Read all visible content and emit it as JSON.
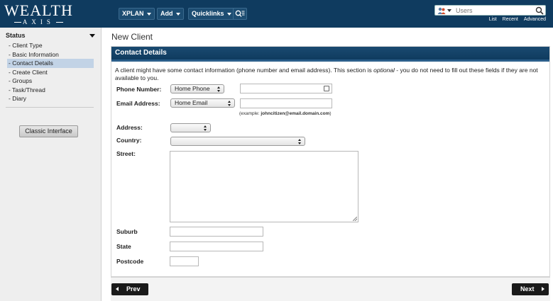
{
  "header": {
    "logo_top": "WEALTH",
    "logo_bottom": "AXIS",
    "nav": [
      {
        "label": "XPLAN"
      },
      {
        "label": "Add"
      },
      {
        "label": "Quicklinks"
      }
    ],
    "user_search_placeholder": "Users",
    "links": [
      "List",
      "Recent",
      "Advanced"
    ]
  },
  "sidebar": {
    "heading": "Status",
    "items": [
      {
        "label": "- Client Type"
      },
      {
        "label": "- Basic Information"
      },
      {
        "label": "- Contact Details"
      },
      {
        "label": "- Create Client"
      },
      {
        "label": "- Groups"
      },
      {
        "label": "- Task/Thread"
      },
      {
        "label": "- Diary"
      }
    ],
    "active_item": "- Contact Details",
    "classic_button": "Classic Interface"
  },
  "main": {
    "page_title": "New Client",
    "section_title": "Contact Details",
    "intro_before": "A client might have some contact information (phone number and email address). This section is ",
    "intro_em": "optional",
    "intro_after": " - you do not need to fill out these fields if they are not available to you.",
    "phone_label": "Phone Number:",
    "phone_type": "Home Phone",
    "phone_value": "",
    "email_label": "Email Address:",
    "email_type": "Home Email",
    "email_value": "",
    "email_example_prefix": "(example: ",
    "email_example": "johncitizen@email.domain.com",
    "email_example_suffix": ")",
    "address_label": "Address:",
    "address_value": "",
    "country_label": "Country:",
    "country_value": "",
    "street_label": "Street:",
    "suburb_label": "Suburb",
    "state_label": "State",
    "postcode_label": "Postcode"
  },
  "footer": {
    "prev_label": "Prev",
    "next_label": "Next"
  },
  "colors": {
    "header_bg": "#0f3b5f",
    "active_item_bg": "#c2d3e6",
    "sidebar_bg": "#eeeeee"
  }
}
